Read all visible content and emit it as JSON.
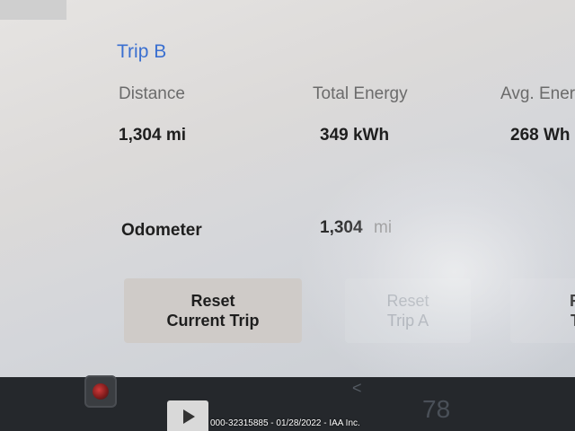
{
  "trip": {
    "title": "Trip B",
    "columns": [
      {
        "label": "Distance",
        "value": "1,304  mi"
      },
      {
        "label": "Total Energy",
        "value": "349  kWh"
      },
      {
        "label": "Avg. Ener",
        "value": "268  Wh"
      }
    ]
  },
  "odometer": {
    "label": "Odometer",
    "value": "1,304",
    "unit": "mi"
  },
  "buttons": {
    "reset_current": "Reset\nCurrent Trip",
    "reset_a": "Reset\nTrip A",
    "partial": "R\nT"
  },
  "taskbar": {
    "chevron": "<",
    "ghost_number": "78",
    "camera_icon": "dashcam-icon",
    "media_icon": "media-player-icon"
  },
  "watermark": "000-32315885 - 01/28/2022 - IAA Inc.",
  "colors": {
    "accent": "#3a6fd0",
    "screen_bg": "#e3e2e1",
    "taskbar_bg": "#25282c"
  }
}
